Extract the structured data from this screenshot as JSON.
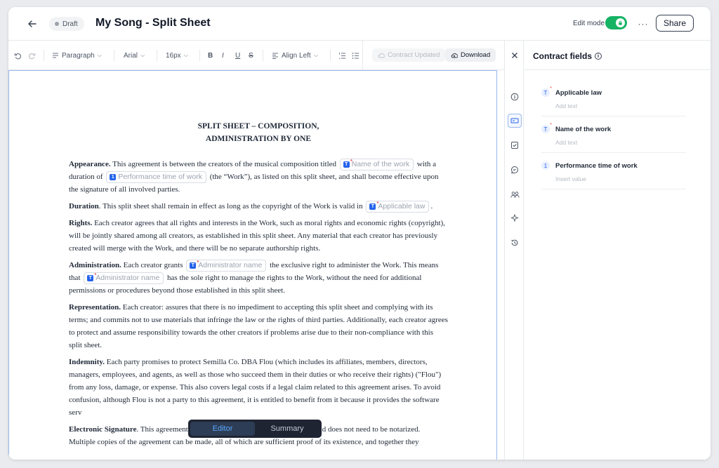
{
  "header": {
    "status": "Draft",
    "title": "My Song - Split Sheet",
    "edit_mode_label": "Edit mode",
    "more_label": "···",
    "share_label": "Share"
  },
  "toolbar": {
    "paragraph_style": "Paragraph",
    "font": "Arial",
    "font_size": "16px",
    "bold": "B",
    "italic": "I",
    "underline": "U",
    "strike": "S",
    "align": "Align Left",
    "contract_updated": "Contract Updated",
    "download": "Download"
  },
  "document": {
    "heading_line1": "SPLIT SHEET – COMPOSITION,",
    "heading_line2": "ADMINISTRATION BY ONE",
    "appearance_label": "Appearance.",
    "appearance_text1": " This agreement is between the creators of the musical composition titled ",
    "appearance_text2": " with a duration of ",
    "appearance_text3": " (the “Work”), as listed on this split sheet, and shall become effective upon the signature of all involved parties.",
    "duration_label": "Duration",
    "duration_text1": ". This split sheet shall remain in effect as long as the copyright of the Work is valid in ",
    "duration_text2": ".",
    "rights_label": "Rights.",
    "rights_text": " Each creator agrees that all rights and interests in the Work, such as moral rights and economic rights (copyright), will be jointly shared among all creators, as established in this split sheet. Any material that each creator has previously created will merge with the Work, and there will be no separate authorship rights.",
    "admin_label": "Administration.",
    "admin_text1": " Each creator grants ",
    "admin_text2": " the exclusive right to administer the Work. This means that ",
    "admin_text3": " has the sole right to manage the rights to the Work, without the need for additional permissions or procedures beyond those established in this split sheet.",
    "repr_label": "Representation.",
    "repr_text": " Each creator: assures that there is no impediment to accepting this split sheet and complying with its terms; and commits not to use materials that infringe the law or the rights of third parties. Additionally, each creator agrees to protect and assume responsibility towards the other creators if problems arise due to their non-compliance with this split sheet.",
    "indemnity_label": "Indemnity.",
    "indemnity_text": " Each party promises to protect Semilla Co. DBA Flou (which includes its affiliates, members, directors, managers, employees, and agents, as well as those who succeed them in their duties or who receive their rights) (\"Flou\") from any loss, damage, or expense. This also covers legal costs if a legal claim related to this agreement arises. To avoid confusion, although Flou is not a party to this agreement, it is entitled to benefit from it because it provides the software serv",
    "esign_label": "Electronic Signature",
    "esign_text": ". This agreement can be signed electronically or by hand, and does not need to be notarized. Multiple copies of the agreement can be made, all of which are sufficient proof of its existence, and together they",
    "chip_name_of_work": "Name of the work",
    "chip_performance_time": "Performance time of work",
    "chip_applicable_law": "Applicable law",
    "chip_admin_name": "Administrator name"
  },
  "mode_switch": {
    "editor": "Editor",
    "summary": "Summary"
  },
  "fields_panel": {
    "title": "Contract fields",
    "fields": [
      {
        "name": "Applicable law",
        "placeholder": "Add text",
        "icon": "text-field-icon"
      },
      {
        "name": "Name of the work",
        "placeholder": "Add text",
        "icon": "text-field-icon"
      },
      {
        "name": "Performance time of work",
        "placeholder": "Insert value",
        "icon": "number-field-icon",
        "icon_text": "1"
      }
    ]
  },
  "colors": {
    "accent": "#2563eb",
    "toggle_on": "#16b364",
    "switch_bg": "#1f2433",
    "switch_active_text": "#58a6ff"
  }
}
